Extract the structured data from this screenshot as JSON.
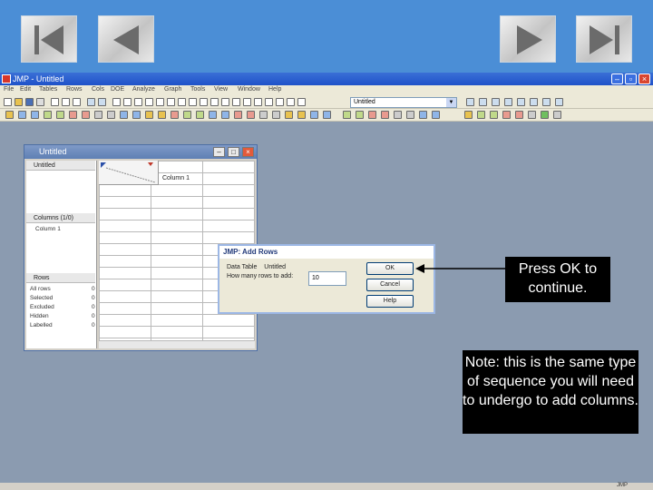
{
  "app": {
    "title": "JMP - Untitled",
    "menu": [
      "File",
      "Edit",
      "Tables",
      "Rows",
      "Cols",
      "DOE",
      "Analyze",
      "Graph",
      "Tools",
      "View",
      "Window",
      "Help"
    ],
    "table_selector": "Untitled",
    "status": "JMP"
  },
  "data_table": {
    "title": "Untitled",
    "table_name": "Untitled",
    "columns_header": "Columns (1/0)",
    "column_name": "Column 1",
    "col_header": "Column 1",
    "rows_header": "Rows",
    "row_states": [
      {
        "label": "All rows",
        "value": "0"
      },
      {
        "label": "Selected",
        "value": "0"
      },
      {
        "label": "Excluded",
        "value": "0"
      },
      {
        "label": "Hidden",
        "value": "0"
      },
      {
        "label": "Labelled",
        "value": "0"
      }
    ]
  },
  "dialog": {
    "title": "JMP: Add Rows",
    "data_table_label": "Data Table",
    "data_table_value": "Untitled",
    "rows_prompt": "How many rows to add:",
    "rows_value": "10",
    "ok_label": "OK",
    "cancel_label": "Cancel",
    "help_label": "Help"
  },
  "callouts": {
    "ok": "Press OK to continue.",
    "note": "Note: this is the same type of sequence you will need to undergo to add columns."
  },
  "colors": {
    "nav_band": "#4b8ed6",
    "workspace": "#8b9bb0",
    "callout_bg": "#000000"
  }
}
